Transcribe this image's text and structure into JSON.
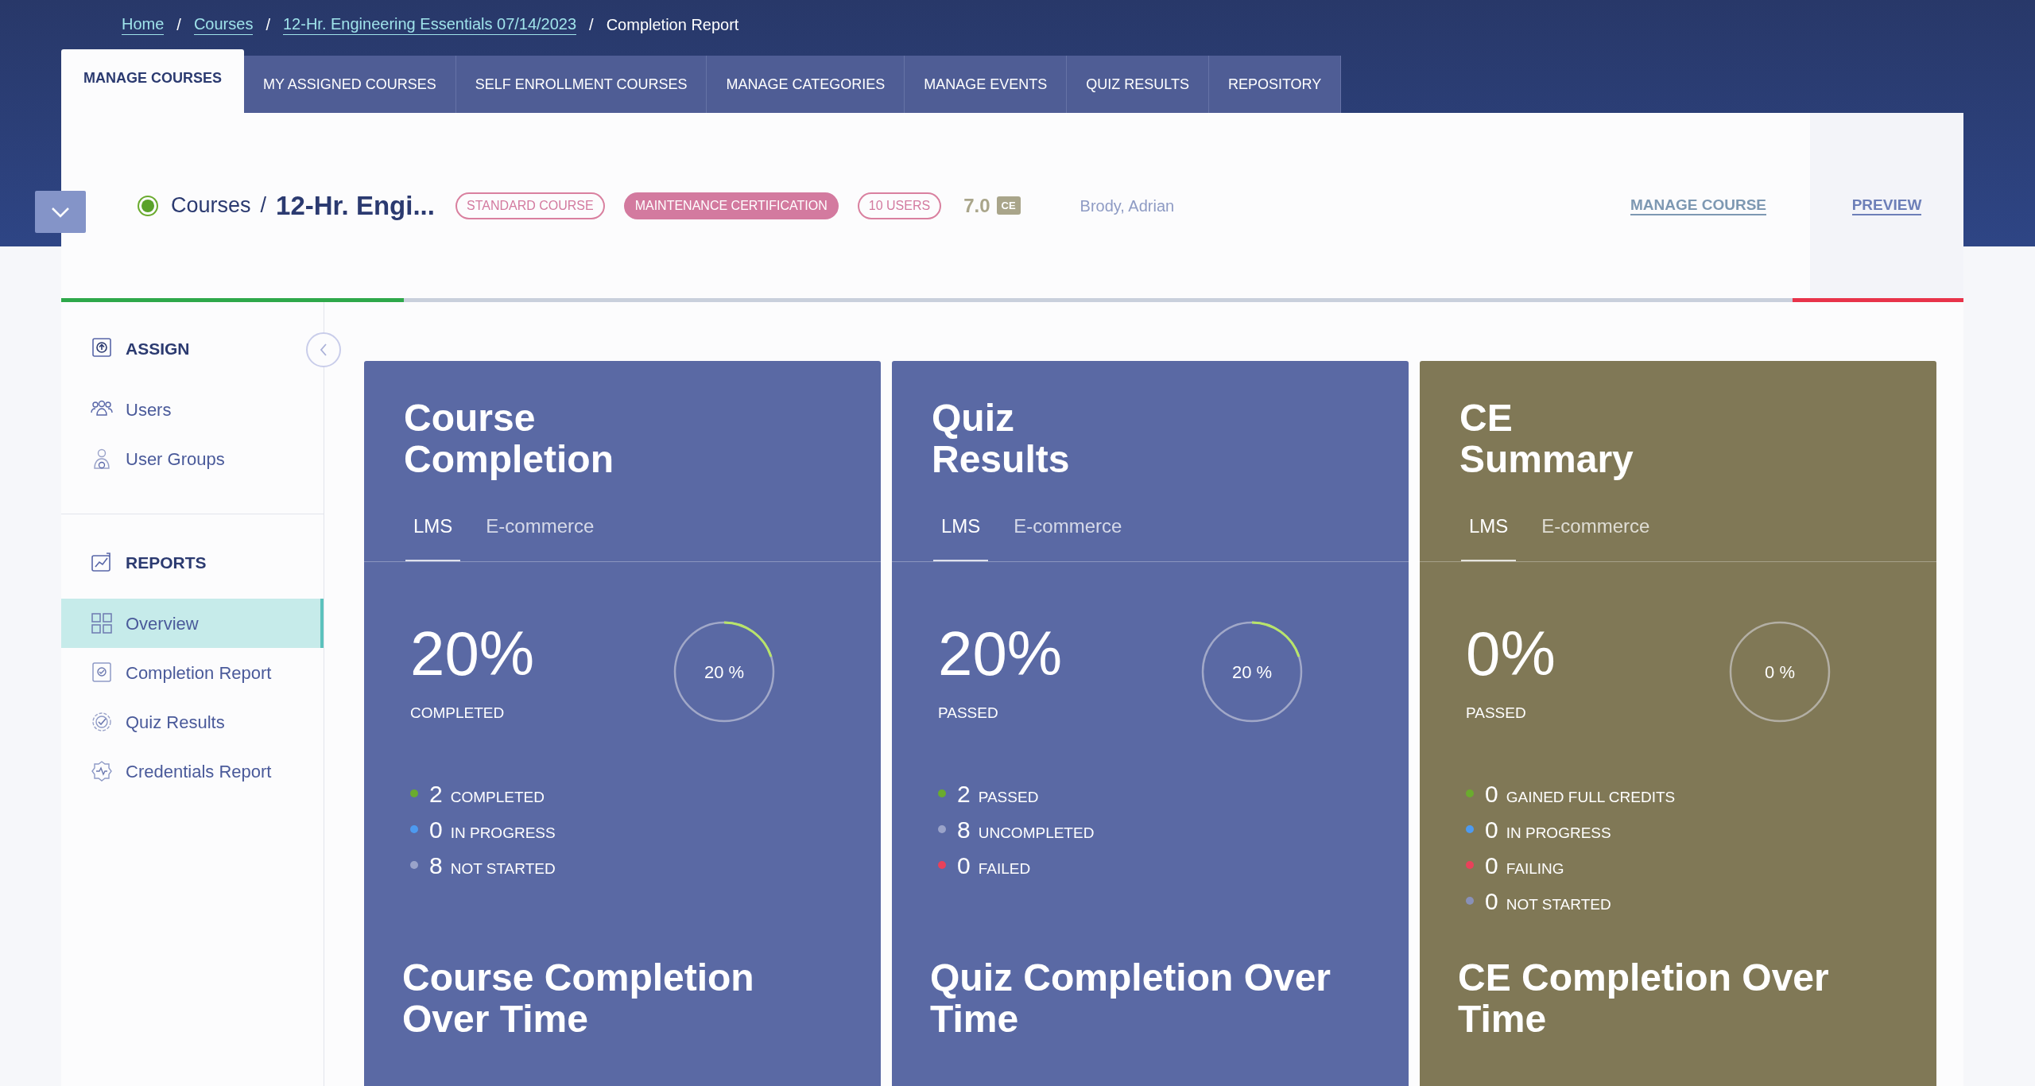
{
  "breadcrumb": [
    {
      "label": "Home",
      "kind": "link"
    },
    {
      "label": "Courses",
      "kind": "link"
    },
    {
      "label": "12-Hr. Engineering Essentials 07/14/2023",
      "kind": "link"
    },
    {
      "label": "Completion Report",
      "kind": "current"
    }
  ],
  "breadcrumb_separator": "/",
  "tabs": [
    {
      "label": "MANAGE COURSES",
      "selected": true
    },
    {
      "label": "MY ASSIGNED COURSES",
      "selected": false
    },
    {
      "label": "SELF ENROLLMENT COURSES",
      "selected": false
    },
    {
      "label": "MANAGE CATEGORIES",
      "selected": false
    },
    {
      "label": "MANAGE EVENTS",
      "selected": false
    },
    {
      "label": "QUIZ RESULTS",
      "selected": false
    },
    {
      "label": "REPOSITORY",
      "selected": false
    }
  ],
  "course_header": {
    "active": true,
    "section": "Courses",
    "separator": "/",
    "title": "12-Hr. Engi...",
    "tags": [
      {
        "label": "STANDARD COURSE",
        "kind": "outline"
      },
      {
        "label": "MAINTENANCE CERTIFICATION",
        "kind": "filled"
      },
      {
        "label": "10 USERS",
        "kind": "outline"
      }
    ],
    "credits": "7.0",
    "credits_badge": "CE",
    "instructor": "Brody, Adrian",
    "actions": [
      "MANAGE COURSE",
      "PREVIEW"
    ]
  },
  "progress_bar": [
    {
      "kind": "complete",
      "level": 0.18
    },
    {
      "kind": "overdue",
      "level": 0.09
    }
  ],
  "sidebar": [
    {
      "title": "ASSIGN",
      "items": [
        {
          "label": "Users",
          "selected": false
        },
        {
          "label": "User Groups",
          "selected": false
        }
      ]
    },
    {
      "title": "REPORTS",
      "items": [
        {
          "label": "Overview",
          "selected": true
        },
        {
          "label": "Completion Report",
          "selected": false
        },
        {
          "label": "Quiz Results",
          "selected": false
        },
        {
          "label": "Credentials Report",
          "selected": false
        }
      ]
    }
  ],
  "cards": [
    {
      "title": "Course Completion",
      "color": "#5a69a4",
      "tabs": [
        {
          "label": "LMS",
          "selected": true
        },
        {
          "label": "E-commerce",
          "selected": false
        }
      ],
      "big_value": "20%",
      "big_label": "COMPLETED",
      "ring": {
        "level": 0.2,
        "text": "20 %"
      },
      "stats": [
        {
          "value": "2",
          "label": "COMPLETED",
          "color": "#6aab2e"
        },
        {
          "value": "0",
          "label": "IN PROGRESS",
          "color": "#4d9af0"
        },
        {
          "value": "8",
          "label": "NOT STARTED",
          "color": "#9aa3c9"
        }
      ],
      "chart_title": "Course Completion Over Time"
    },
    {
      "title": "Quiz Results",
      "color": "#5a69a4",
      "tabs": [
        {
          "label": "LMS",
          "selected": true
        },
        {
          "label": "E-commerce",
          "selected": false
        }
      ],
      "big_value": "20%",
      "big_label": "PASSED",
      "ring": {
        "level": 0.2,
        "text": "20 %"
      },
      "stats": [
        {
          "value": "2",
          "label": "PASSED",
          "color": "#6aab2e"
        },
        {
          "value": "8",
          "label": "UNCOMPLETED",
          "color": "#9aa3c9"
        },
        {
          "value": "0",
          "label": "FAILED",
          "color": "#e8415a"
        }
      ],
      "chart_title": "Quiz Completion Over Time"
    },
    {
      "title": "CE Summary",
      "color": "#807856",
      "tabs": [
        {
          "label": "LMS",
          "selected": true
        },
        {
          "label": "E-commerce",
          "selected": false
        }
      ],
      "big_value": "0%",
      "big_label": "PASSED",
      "ring": {
        "level": 0,
        "text": "0 %"
      },
      "stats": [
        {
          "value": "0",
          "label": "GAINED FULL CREDITS",
          "color": "#6aab2e"
        },
        {
          "value": "0",
          "label": "IN PROGRESS",
          "color": "#4d9af0"
        },
        {
          "value": "0",
          "label": "FAILING",
          "color": "#e8415a"
        },
        {
          "value": "0",
          "label": "NOT STARTED",
          "color": "#8890b8"
        }
      ],
      "chart_title": "CE Completion Over Time"
    }
  ]
}
